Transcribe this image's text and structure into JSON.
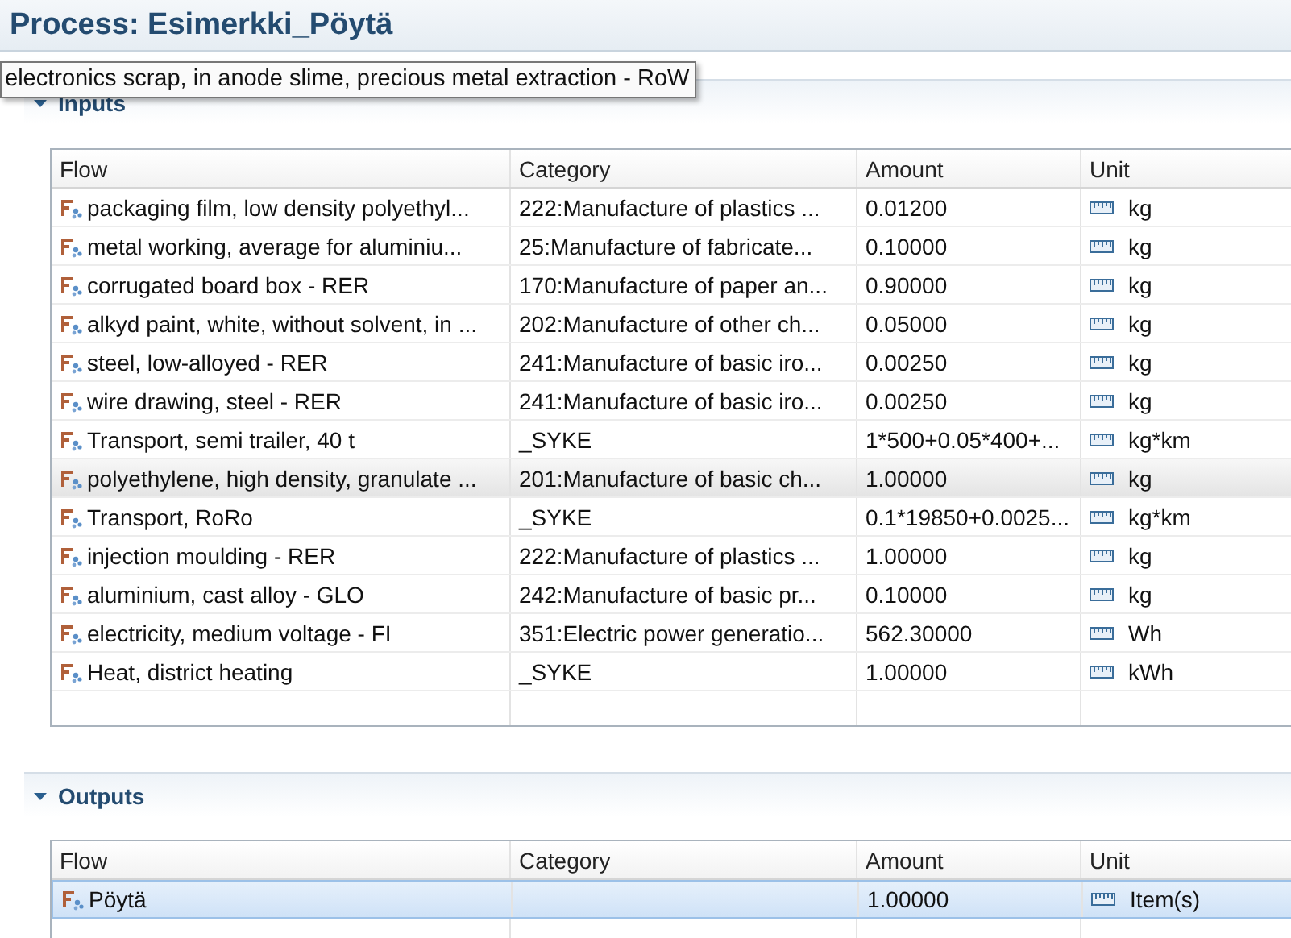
{
  "title": "Process: Esimerkki_Pöytä",
  "tooltip": "electronics scrap, in anode slime, precious metal extraction - RoW",
  "sections": [
    {
      "title": "Inputs",
      "expanded": true,
      "columns": [
        "Flow",
        "Category",
        "Amount",
        "Unit"
      ],
      "rows": [
        {
          "flow": "packaging film, low density polyethyl...",
          "category": "222:Manufacture of plastics ...",
          "amount": "0.01200",
          "unit": "kg",
          "hovered": false,
          "selected": false
        },
        {
          "flow": "metal working, average for aluminiu...",
          "category": "25:Manufacture of fabricate...",
          "amount": "0.10000",
          "unit": "kg",
          "hovered": false,
          "selected": false
        },
        {
          "flow": "corrugated board box - RER",
          "category": "170:Manufacture of paper an...",
          "amount": "0.90000",
          "unit": "kg",
          "hovered": false,
          "selected": false
        },
        {
          "flow": "alkyd paint, white, without solvent, in ...",
          "category": "202:Manufacture of other ch...",
          "amount": "0.05000",
          "unit": "kg",
          "hovered": false,
          "selected": false
        },
        {
          "flow": "steel, low-alloyed - RER",
          "category": "241:Manufacture of basic iro...",
          "amount": "0.00250",
          "unit": "kg",
          "hovered": false,
          "selected": false
        },
        {
          "flow": "wire drawing, steel - RER",
          "category": "241:Manufacture of basic iro...",
          "amount": "0.00250",
          "unit": "kg",
          "hovered": false,
          "selected": false
        },
        {
          "flow": "Transport, semi trailer, 40 t",
          "category": "_SYKE",
          "amount": "1*500+0.05*400+...",
          "unit": "kg*km",
          "hovered": false,
          "selected": false
        },
        {
          "flow": "polyethylene, high density, granulate ...",
          "category": "201:Manufacture of basic ch...",
          "amount": "1.00000",
          "unit": "kg",
          "hovered": true,
          "selected": false
        },
        {
          "flow": "Transport, RoRo",
          "category": "_SYKE",
          "amount": "0.1*19850+0.0025...",
          "unit": "kg*km",
          "hovered": false,
          "selected": false
        },
        {
          "flow": "injection moulding - RER",
          "category": "222:Manufacture of plastics ...",
          "amount": "1.00000",
          "unit": "kg",
          "hovered": false,
          "selected": false
        },
        {
          "flow": "aluminium, cast alloy - GLO",
          "category": "242:Manufacture of basic pr...",
          "amount": "0.10000",
          "unit": "kg",
          "hovered": false,
          "selected": false
        },
        {
          "flow": "electricity, medium voltage - FI",
          "category": "351:Electric power generatio...",
          "amount": "562.30000",
          "unit": "Wh",
          "hovered": false,
          "selected": false
        },
        {
          "flow": "Heat, district heating",
          "category": "_SYKE",
          "amount": "1.00000",
          "unit": "kWh",
          "hovered": false,
          "selected": false
        }
      ]
    },
    {
      "title": "Outputs",
      "expanded": true,
      "columns": [
        "Flow",
        "Category",
        "Amount",
        "Unit"
      ],
      "rows": [
        {
          "flow": "Pöytä",
          "amount": "1.00000",
          "unit": "Item(s)",
          "hovered": false,
          "selected": true
        }
      ]
    }
  ]
}
